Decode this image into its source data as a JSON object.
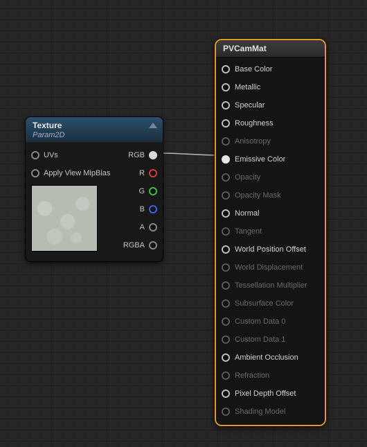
{
  "texture_node": {
    "title": "Texture",
    "subtitle": "Param2D",
    "inputs": {
      "uvs": "UVs",
      "mipbias": "Apply View MipBias"
    },
    "outputs": {
      "rgb": "RGB",
      "r": "R",
      "g": "G",
      "b": "B",
      "a": "A",
      "rgba": "RGBA"
    }
  },
  "material_node": {
    "title": "PVCamMat",
    "pins": [
      {
        "key": "base_color",
        "label": "Base Color",
        "enabled": true,
        "connected": false
      },
      {
        "key": "metallic",
        "label": "Metallic",
        "enabled": true,
        "connected": false
      },
      {
        "key": "specular",
        "label": "Specular",
        "enabled": true,
        "connected": false
      },
      {
        "key": "roughness",
        "label": "Roughness",
        "enabled": true,
        "connected": false
      },
      {
        "key": "anisotropy",
        "label": "Anisotropy",
        "enabled": false,
        "connected": false
      },
      {
        "key": "emissive",
        "label": "Emissive Color",
        "enabled": true,
        "connected": true
      },
      {
        "key": "opacity",
        "label": "Opacity",
        "enabled": false,
        "connected": false
      },
      {
        "key": "opacity_mask",
        "label": "Opacity Mask",
        "enabled": false,
        "connected": false
      },
      {
        "key": "normal",
        "label": "Normal",
        "enabled": true,
        "connected": false
      },
      {
        "key": "tangent",
        "label": "Tangent",
        "enabled": false,
        "connected": false
      },
      {
        "key": "wpo",
        "label": "World Position Offset",
        "enabled": true,
        "connected": false
      },
      {
        "key": "world_disp",
        "label": "World Displacement",
        "enabled": false,
        "connected": false
      },
      {
        "key": "tess_mult",
        "label": "Tessellation Multiplier",
        "enabled": false,
        "connected": false
      },
      {
        "key": "subsurface",
        "label": "Subsurface Color",
        "enabled": false,
        "connected": false
      },
      {
        "key": "custom0",
        "label": "Custom Data 0",
        "enabled": false,
        "connected": false
      },
      {
        "key": "custom1",
        "label": "Custom Data 1",
        "enabled": false,
        "connected": false
      },
      {
        "key": "ao",
        "label": "Ambient Occlusion",
        "enabled": true,
        "connected": false
      },
      {
        "key": "refraction",
        "label": "Refraction",
        "enabled": false,
        "connected": false
      },
      {
        "key": "pdo",
        "label": "Pixel Depth Offset",
        "enabled": true,
        "connected": false
      },
      {
        "key": "shading_model",
        "label": "Shading Model",
        "enabled": false,
        "connected": false
      }
    ]
  }
}
